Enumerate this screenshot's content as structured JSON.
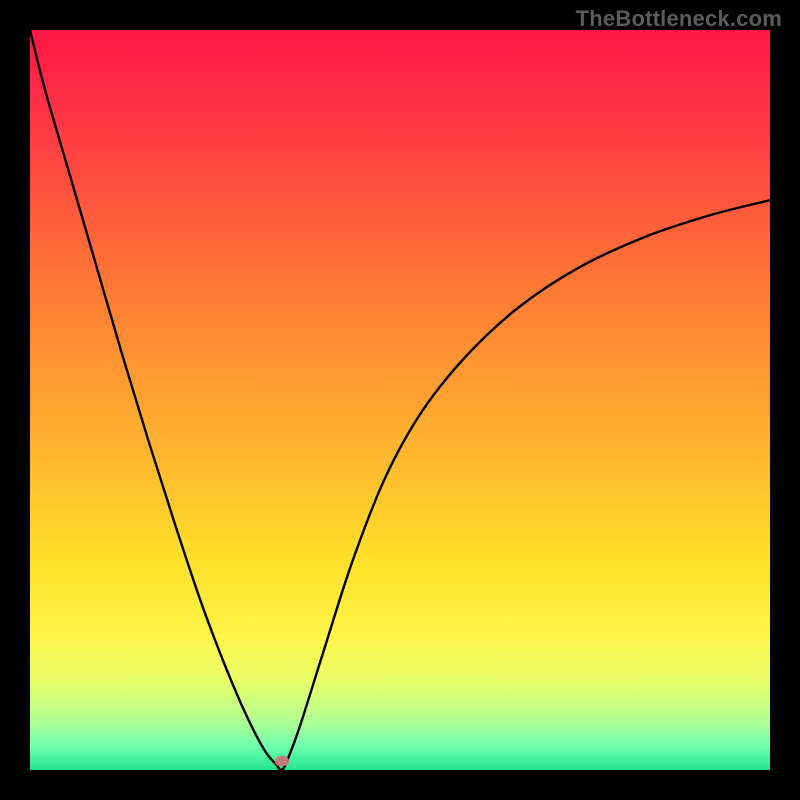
{
  "watermark": "TheBottleneck.com",
  "chart_data": {
    "type": "line",
    "title": "",
    "xlabel": "",
    "ylabel": "",
    "xlim": [
      0,
      1
    ],
    "ylim": [
      0,
      1
    ],
    "grid": false,
    "legend": false,
    "background": "vertical-gradient red→orange→yellow→green (traffic-light)",
    "series": [
      {
        "name": "bottleneck-curve",
        "x": [
          0.0,
          0.02,
          0.055,
          0.09,
          0.125,
          0.16,
          0.195,
          0.23,
          0.26,
          0.285,
          0.305,
          0.32,
          0.332,
          0.34,
          0.348,
          0.365,
          0.395,
          0.435,
          0.48,
          0.53,
          0.59,
          0.66,
          0.74,
          0.83,
          0.92,
          1.0
        ],
        "y": [
          1.0,
          0.92,
          0.8,
          0.68,
          0.56,
          0.445,
          0.335,
          0.23,
          0.15,
          0.09,
          0.048,
          0.022,
          0.008,
          0.0,
          0.014,
          0.06,
          0.155,
          0.28,
          0.395,
          0.485,
          0.56,
          0.625,
          0.678,
          0.72,
          0.75,
          0.77
        ]
      }
    ],
    "annotations": [
      {
        "name": "min-marker",
        "shape": "rounded-rect",
        "color": "#c57c78",
        "x": 0.34,
        "y": 0.012
      }
    ]
  },
  "colors": {
    "frame": "#000000",
    "curve_stroke": "#000000",
    "marker_fill": "#c57c78",
    "watermark_text": "#5b5b5b"
  }
}
